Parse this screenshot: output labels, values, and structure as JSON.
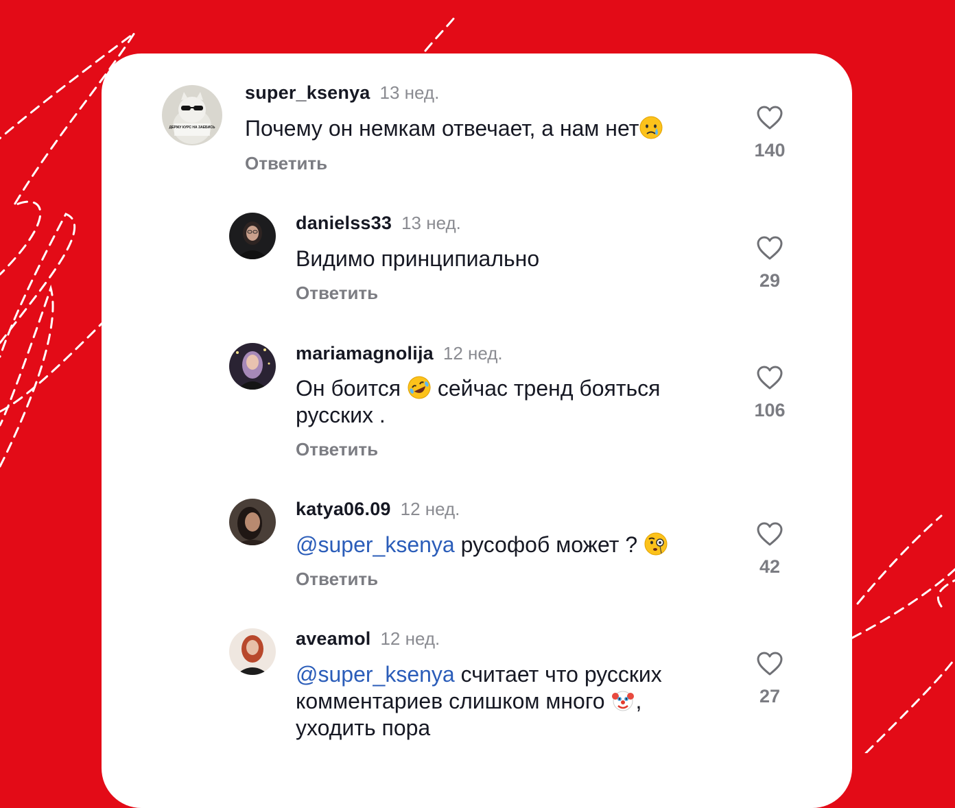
{
  "comments": [
    {
      "user": "super_ksenya",
      "time": "13 нед.",
      "text": "Почему он немкам отвечает, а нам нет",
      "reply": "Ответить",
      "likes": "140"
    },
    {
      "user": "danielss33",
      "time": "13 нед.",
      "text": "Видимо принципиально",
      "reply": "Ответить",
      "likes": "29"
    },
    {
      "user": "mariamagnolija",
      "time": "12 нед.",
      "text_a": "Он боится",
      "text_b": "сейчас тренд бояться русских .",
      "reply": "Ответить",
      "likes": "106"
    },
    {
      "user": "katya06.09",
      "time": "12 нед.",
      "mention": "@super_ksenya",
      "text": "русофоб может ?",
      "reply": "Ответить",
      "likes": "42"
    },
    {
      "user": "aveamol",
      "time": "12 нед.",
      "mention": "@super_ksenya",
      "text_a": "считает что русских комментариев слишком много",
      "text_b": ", уходить пора",
      "likes": "27"
    }
  ],
  "avatars": {
    "a0": "ДЕРЖУ КУРС НА ЗАЕБИСЬ"
  },
  "colors": {
    "background": "#e30b17",
    "card": "#ffffff",
    "username": "#161823",
    "muted": "#7b7c82",
    "mention": "#2b5db9"
  },
  "icons": [
    "heart-outline-icon",
    "crying-face-emoji",
    "rofl-emoji",
    "monocle-face-emoji",
    "clown-face-emoji"
  ]
}
